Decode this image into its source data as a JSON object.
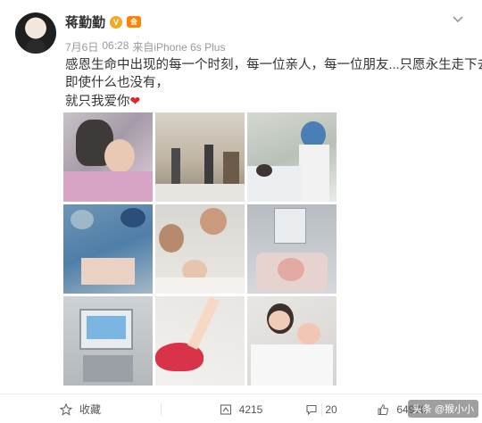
{
  "user": {
    "name": "蒋勤勤",
    "verified_badge": "V",
    "member_badge": "会"
  },
  "meta": {
    "date": "7月6日",
    "time": "06:28",
    "source": "来自iPhone 6s Plus"
  },
  "post": {
    "lines": [
      "感恩生命中出现的每一个时刻，每一位亲人，每一位朋友...只愿永生走下去，",
      "即使什么也没有，",
      "就只我爱你"
    ],
    "emoji": "❤"
  },
  "actions": {
    "favorite": {
      "icon": "star-icon",
      "label": "收藏"
    },
    "repost": {
      "icon": "repost-icon",
      "count": "4215"
    },
    "comment": {
      "icon": "comment-icon",
      "count": "20"
    },
    "like": {
      "icon": "thumbs-up-icon",
      "count": "64976"
    }
  },
  "watermark": "头条 @猴小小",
  "colors": {
    "name": "#333333",
    "meta": "#999999",
    "heart": "#e0262c",
    "verified": "#f5a623"
  }
}
